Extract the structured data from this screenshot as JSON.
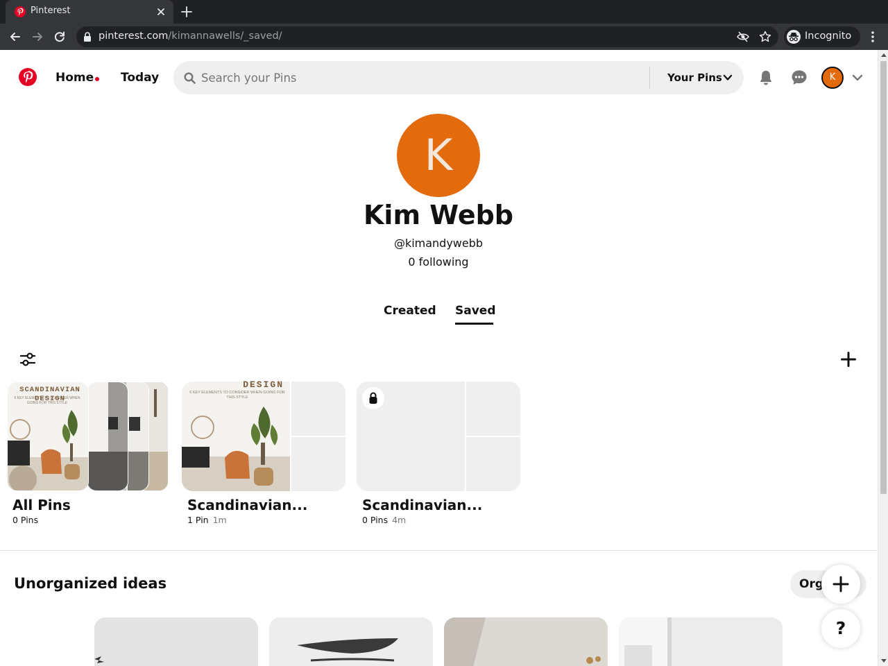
{
  "browser": {
    "tab_title": "Pinterest",
    "url_host": "pinterest.com",
    "url_path": "/kimannawells/_saved/",
    "incognito_label": "Incognito"
  },
  "header": {
    "home_label": "Home",
    "today_label": "Today",
    "search_placeholder": "Search your Pins",
    "search_value": "",
    "scope_label": "Your Pins",
    "avatar_initial": "K",
    "brand_color": "#e60023",
    "avatar_color": "#e36b0d"
  },
  "profile": {
    "initial": "K",
    "name": "Kim Webb",
    "handle": "@kimandywebb",
    "following": "0 following"
  },
  "tabs": {
    "created": "Created",
    "saved": "Saved",
    "active": "Saved"
  },
  "boards": [
    {
      "title": "All Pins",
      "count": "0 Pins",
      "time": "",
      "cover_text": "SCANDINAVIAN DESIGN",
      "cover_sub": "6 KEY ELEMENTS TO CONSIDER WHEN GOING FOR THIS STYLE"
    },
    {
      "title": "Scandinavian...",
      "count": "1 Pin",
      "time": "1m",
      "cover_text": "DESIGN",
      "cover_sub": "6 KEY ELEMENTS TO CONSIDER WHEN GOING FOR THIS STYLE"
    },
    {
      "title": "Scandinavian...",
      "count": "0 Pins",
      "time": "4m",
      "secret": true
    }
  ],
  "unorganized": {
    "title": "Unorganized ideas",
    "organize_label": "Org"
  },
  "fab": {
    "help_label": "?"
  }
}
